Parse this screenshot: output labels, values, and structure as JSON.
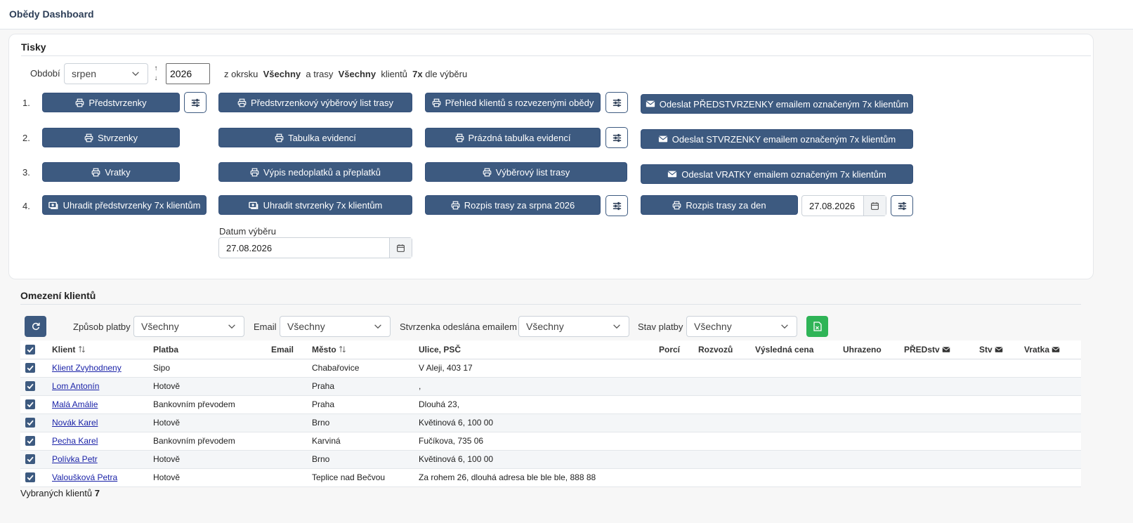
{
  "app": {
    "title": "Obědy Dashboard"
  },
  "print": {
    "title": "Tisky",
    "period_label": "Období",
    "month_value": "srpen",
    "year_value": "2026",
    "summary": {
      "prefix": "z okrsku",
      "district": "Všechny",
      "mid": "a trasy",
      "route": "Všechny",
      "clients_word": "klientů",
      "count": "7x",
      "suffix": "dle výběru"
    },
    "rows": [
      "1.",
      "2.",
      "3.",
      "4."
    ],
    "buttons": {
      "predstvrzenky": "Předstvrzenky",
      "predstvrzenkovy_list": "Předstvrzenkový výběrový list trasy",
      "prehled_klientu": "Přehled klientů s rozvezenými obědy",
      "send_predstvrzenky": "Odeslat PŘEDSTVRZENKY emailem označeným 7x klientům",
      "stvrzenky": "Stvrzenky",
      "tabulka_evidenci": "Tabulka evidencí",
      "prazdna_tabulka": "Prázdná tabulka evidencí",
      "send_stvrzenky": "Odeslat STVRZENKY emailem označeným 7x klientům",
      "vratky": "Vratky",
      "vypis_nedoplatku": "Výpis nedoplatků a přeplatků",
      "vyberovy_list": "Výběrový list trasy",
      "send_vratky": "Odeslat VRATKY emailem označeným 7x klientům",
      "uhradit_predstvrzenky": "Uhradit předstvrzenky 7x klientům",
      "uhradit_stvrzenky": "Uhradit stvrzenky 7x klientům",
      "rozpis_mesic": "Rozpis trasy za srpna 2026",
      "rozpis_den": "Rozpis trasy za den"
    },
    "rozpis_den_date": "27.08.2026",
    "selection_date_label": "Datum výběru",
    "selection_date": "27.08.2026"
  },
  "clients": {
    "title": "Omezení klientů",
    "filters": {
      "payment_label": "Způsob platby",
      "payment_value": "Všechny",
      "email_label": "Email",
      "email_value": "Všechny",
      "receipt_label": "Stvrzenka odeslána emailem",
      "receipt_value": "Všechny",
      "status_label": "Stav platby",
      "status_value": "Všechny"
    },
    "columns": {
      "client": "Klient",
      "platba": "Platba",
      "email": "Email",
      "mesto": "Město",
      "ulice": "Ulice, PSČ",
      "porci": "Porcí",
      "rozvozu": "Rozvozů",
      "cena": "Výsledná cena",
      "uhrazeno": "Uhrazeno",
      "predstv": "PŘEDstv",
      "stv": "Stv",
      "vratka": "Vratka"
    },
    "rows": [
      {
        "name": "Klient Zvyhodneny",
        "platba": "Sipo",
        "email": "",
        "mesto": "Chabařovice",
        "ulice": "V Aleji, 403 17"
      },
      {
        "name": "Lom Antonín",
        "platba": "Hotově",
        "email": "",
        "mesto": "Praha",
        "ulice": ","
      },
      {
        "name": "Malá Amálie",
        "platba": "Bankovním převodem",
        "email": "",
        "mesto": "Praha",
        "ulice": "Dlouhá 23,"
      },
      {
        "name": "Novák Karel",
        "platba": "Hotově",
        "email": "",
        "mesto": "Brno",
        "ulice": "Květinová 6, 100 00"
      },
      {
        "name": "Pecha Karel",
        "platba": "Bankovním převodem",
        "email": "",
        "mesto": "Karviná",
        "ulice": "Fučíkova, 735 06"
      },
      {
        "name": "Polívka Petr",
        "platba": "Hotově",
        "email": "",
        "mesto": "Brno",
        "ulice": "Květinová 6, 100 00"
      },
      {
        "name": "Valoušková Petra",
        "platba": "Hotově",
        "email": "",
        "mesto": "Teplice nad Bečvou",
        "ulice": "Za rohem 26, dlouhá adresa ble ble ble, 888 88"
      }
    ],
    "footer_label": "Vybraných klientů",
    "footer_count": "7"
  },
  "colors": {
    "primary": "#3d5a80",
    "excel": "#2fb457",
    "link": "#1b23a8"
  }
}
